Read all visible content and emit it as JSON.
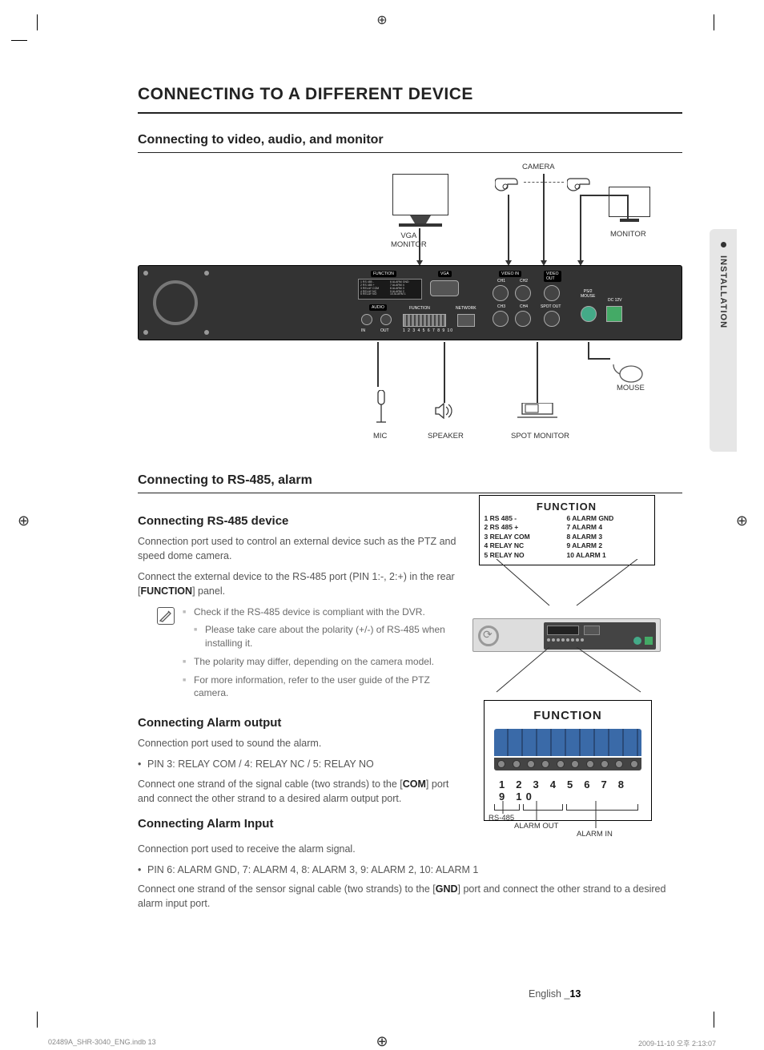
{
  "page": {
    "h1": "CONNECTING TO A DIFFERENT DEVICE",
    "section1_h2": "Connecting to video, audio, and monitor",
    "section2_h2": "Connecting to RS-485, alarm",
    "footer_lang": "English _",
    "footer_num": "13",
    "print_left": "02489A_SHR-3040_ENG.indb   13",
    "print_right": "2009-11-10   오후 2:13:07",
    "side_tab": "INSTALLATION"
  },
  "diagram1": {
    "camera": "CAMERA",
    "vga_monitor": "VGA\nMONITOR",
    "monitor": "MONITOR",
    "mouse": "MOUSE",
    "mic": "MIC",
    "speaker": "SPEAKER",
    "spot_monitor": "SPOT MONITOR",
    "rear_labels": {
      "function": "FUNCTION",
      "audio": "AUDIO",
      "in": "IN",
      "out": "OUT",
      "vga": "VGA",
      "network": "NETWORK",
      "video_in": "VIDEO IN",
      "video_out": "VIDEO OUT",
      "ch1": "CH1",
      "ch2": "CH2",
      "ch3": "CH3",
      "ch4": "CH4",
      "spot_out": "SPOT OUT",
      "ps2_mouse": "PS/2\nMOUSE",
      "dc12v": "DC 12V",
      "pins": "1 2 3 4 5 6 7 8 9 10",
      "func_pins_left": [
        "1 RS 485 -",
        "2 RS 485 +",
        "3 RELAY COM",
        "4 RELAY NC",
        "5 RELAY NO"
      ],
      "func_pins_right": [
        "6 ALARM GND",
        "7 ALARM 4",
        "8 ALARM 3",
        "9 ALARM 2",
        "10 ALARM 1"
      ]
    }
  },
  "rs485": {
    "h3": "Connecting RS-485 device",
    "p1": "Connection port used to control an external device such as the PTZ and speed dome camera.",
    "p2a": "Connect the external device to the RS-485 port (PIN 1:-, 2:+) in the rear [",
    "p2b": "FUNCTION",
    "p2c": "] panel.",
    "notes": [
      "Check if the RS-485 device is compliant with the DVR.",
      "Please take care about the polarity (+/-) of RS-485 when installing it.",
      "The polarity may differ, depending on the camera model.",
      "For more information, refer to the user guide of the PTZ camera."
    ]
  },
  "alarm_out": {
    "h3": "Connecting Alarm output",
    "p1": "Connection port used to sound the alarm.",
    "b1": "PIN 3: RELAY COM / 4: RELAY NC / 5: RELAY NO",
    "p2a": "Connect one strand of the signal cable (two strands) to the [",
    "p2b": "COM",
    "p2c": "] port and connect the other strand to a desired alarm output port."
  },
  "alarm_in": {
    "h3": "Connecting Alarm Input",
    "p1": "Connection port used to receive the alarm signal.",
    "b1": "PIN 6: ALARM GND, 7: ALARM 4, 8: ALARM 3, 9: ALARM 2, 10: ALARM 1",
    "p2a": "Connect one strand of the sensor signal cable (two strands) to the [",
    "p2b": "GND",
    "p2c": "] port and connect the other strand to a desired alarm input port."
  },
  "func_diagram": {
    "title": "FUNCTION",
    "left_col": [
      "1  RS 485  -",
      "2  RS 485  +",
      "3  RELAY COM",
      "4  RELAY NC",
      "5  RELAY NO"
    ],
    "right_col": [
      "6  ALARM GND",
      "7  ALARM  4",
      "8  ALARM  3",
      "9  ALARM  2",
      "10 ALARM  1"
    ],
    "numbers": "1 2 3 4 5 6 7 8 9 10",
    "rs485_label": "RS-485",
    "alarm_out_label": "ALARM OUT",
    "alarm_in_label": "ALARM IN"
  }
}
